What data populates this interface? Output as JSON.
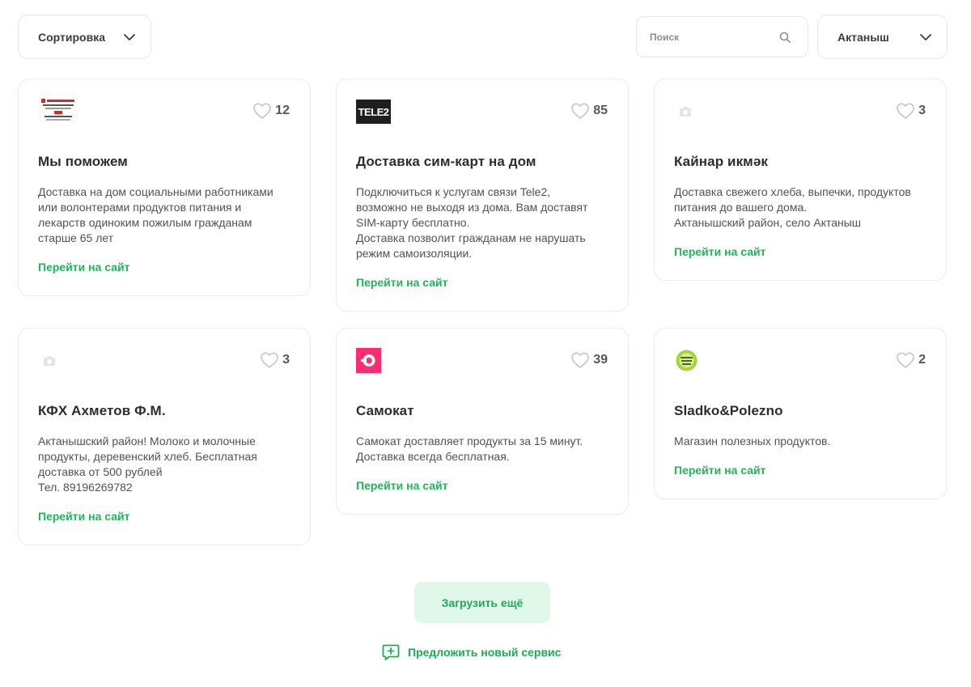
{
  "toolbar": {
    "sort_label": "Сортировка",
    "search_placeholder": "Поиск",
    "search_value": "",
    "city_label": "Актаныш"
  },
  "colors": {
    "accent": "#21b55a",
    "load_more_bg": "#e0f8ea",
    "samokat_brand": "#ff2d6f",
    "tele2_brand": "#1f1f1f"
  },
  "cards": [
    {
      "logo": "my-pomozhem-logo",
      "likes": "12",
      "title": "Мы поможем",
      "description": "Доставка на дом социальными работниками\nили волонтерами продуктов питания и\nлекарств одиноким пожилым гражданам\nстарше 65 лет",
      "link": "Перейти на сайт"
    },
    {
      "logo": "tele2-logo",
      "logo_text": "TELE2",
      "likes": "85",
      "title": "Доставка сим-карт на дом",
      "description": "Подключиться к услугам связи Tele2,\nвозможно не выходя из дома. Вам доставят\nSIM-карту бесплатно.\nДоставка позволит гражданам не нарушать\nрежим самоизоляции.",
      "link": "Перейти на сайт"
    },
    {
      "logo": "camera-placeholder-icon",
      "likes": "3",
      "title": "Кайнар икмәк",
      "description": "Доставка свежего хлеба, выпечки, продуктов\nпитания до вашего дома.\nАктанышский район, село Актаныш",
      "link": "Перейти на сайт"
    },
    {
      "logo": "camera-placeholder-icon",
      "likes": "3",
      "title": "КФХ Ахметов Ф.М.",
      "description": "Актанышский район! Молоко и молочные\nпродукты, деревенский хлеб. Бесплатная\nдоставка от 500 рублей\nТел. 89196269782",
      "link": "Перейти на сайт"
    },
    {
      "logo": "samokat-logo",
      "likes": "39",
      "title": "Самокат",
      "description": "Самокат доставляет продукты за 15 минут.\nДоставка всегда бесплатная.",
      "link": "Перейти на сайт"
    },
    {
      "logo": "sladko-polezno-logo",
      "likes": "2",
      "title": "Sladko&Polezno",
      "description": "Магазин полезных продуктов.",
      "link": "Перейти на сайт"
    }
  ],
  "footer": {
    "load_more_label": "Загрузить ещё",
    "suggest_label": "Предложить новый сервис"
  }
}
